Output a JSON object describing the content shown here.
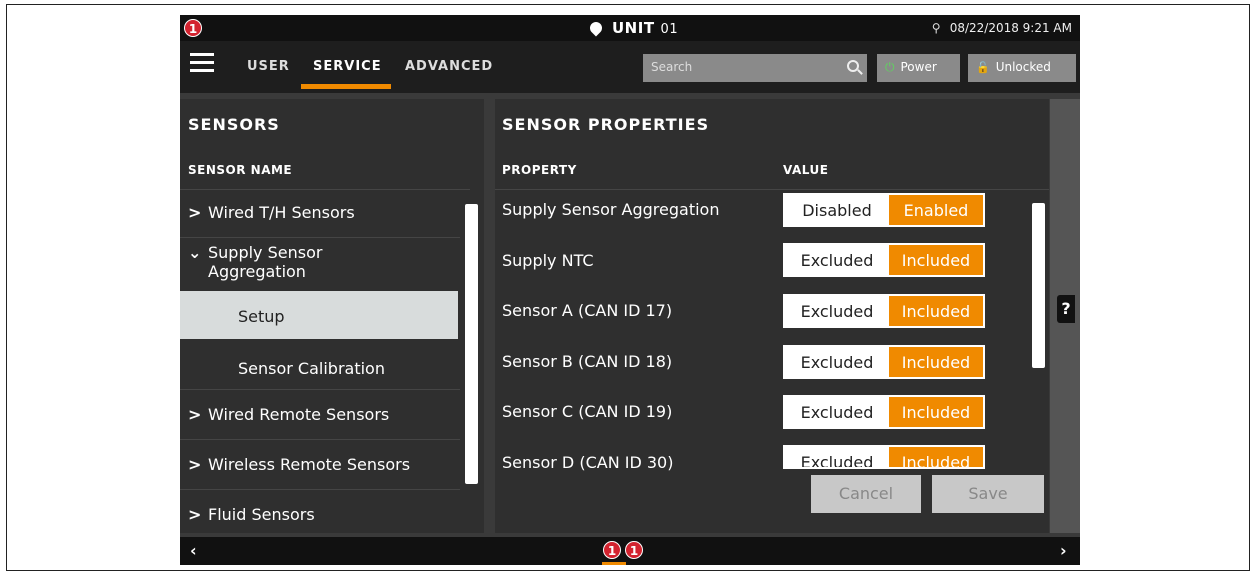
{
  "status": {
    "alert_count": "1",
    "unit_label": "UNIT",
    "unit_number": "01",
    "datetime": "08/22/2018 9:21 AM"
  },
  "nav": {
    "tabs": [
      "USER",
      "SERVICE",
      "ADVANCED"
    ],
    "active_tab": "SERVICE",
    "search_placeholder": "Search",
    "power_label": "Power",
    "lock_label": "Unlocked"
  },
  "sensors_panel": {
    "title": "SENSORS",
    "column_header": "SENSOR NAME",
    "items": [
      {
        "label": "Wired T/H Sensors",
        "chevron": ">"
      },
      {
        "label": "Supply Sensor",
        "label2": "Aggregation",
        "chevron": "⌄"
      },
      {
        "label": "Setup"
      },
      {
        "label": "Sensor Calibration"
      },
      {
        "label": "Wired Remote Sensors",
        "chevron": ">"
      },
      {
        "label": "Wireless Remote Sensors",
        "chevron": ">"
      },
      {
        "label": "Fluid Sensors",
        "chevron": ">"
      }
    ]
  },
  "properties_panel": {
    "title": "SENSOR PROPERTIES",
    "property_header": "PROPERTY",
    "value_header": "VALUE",
    "rows": [
      {
        "property": "Supply Sensor Aggregation",
        "off": "Disabled",
        "on": "Enabled"
      },
      {
        "property": "Supply NTC",
        "off": "Excluded",
        "on": "Included"
      },
      {
        "property": "Sensor A (CAN ID 17)",
        "off": "Excluded",
        "on": "Included"
      },
      {
        "property": "Sensor B (CAN ID 18)",
        "off": "Excluded",
        "on": "Included"
      },
      {
        "property": "Sensor C (CAN ID 19)",
        "off": "Excluded",
        "on": "Included"
      },
      {
        "property": "Sensor D (CAN ID 30)",
        "off": "Excluded",
        "on": "Included"
      }
    ],
    "cancel_label": "Cancel",
    "save_label": "Save"
  },
  "help": {
    "label": "?"
  },
  "bottom": {
    "alerts": [
      "1",
      "1"
    ]
  },
  "colors": {
    "accent": "#f08a00",
    "alert": "#d3232f"
  }
}
